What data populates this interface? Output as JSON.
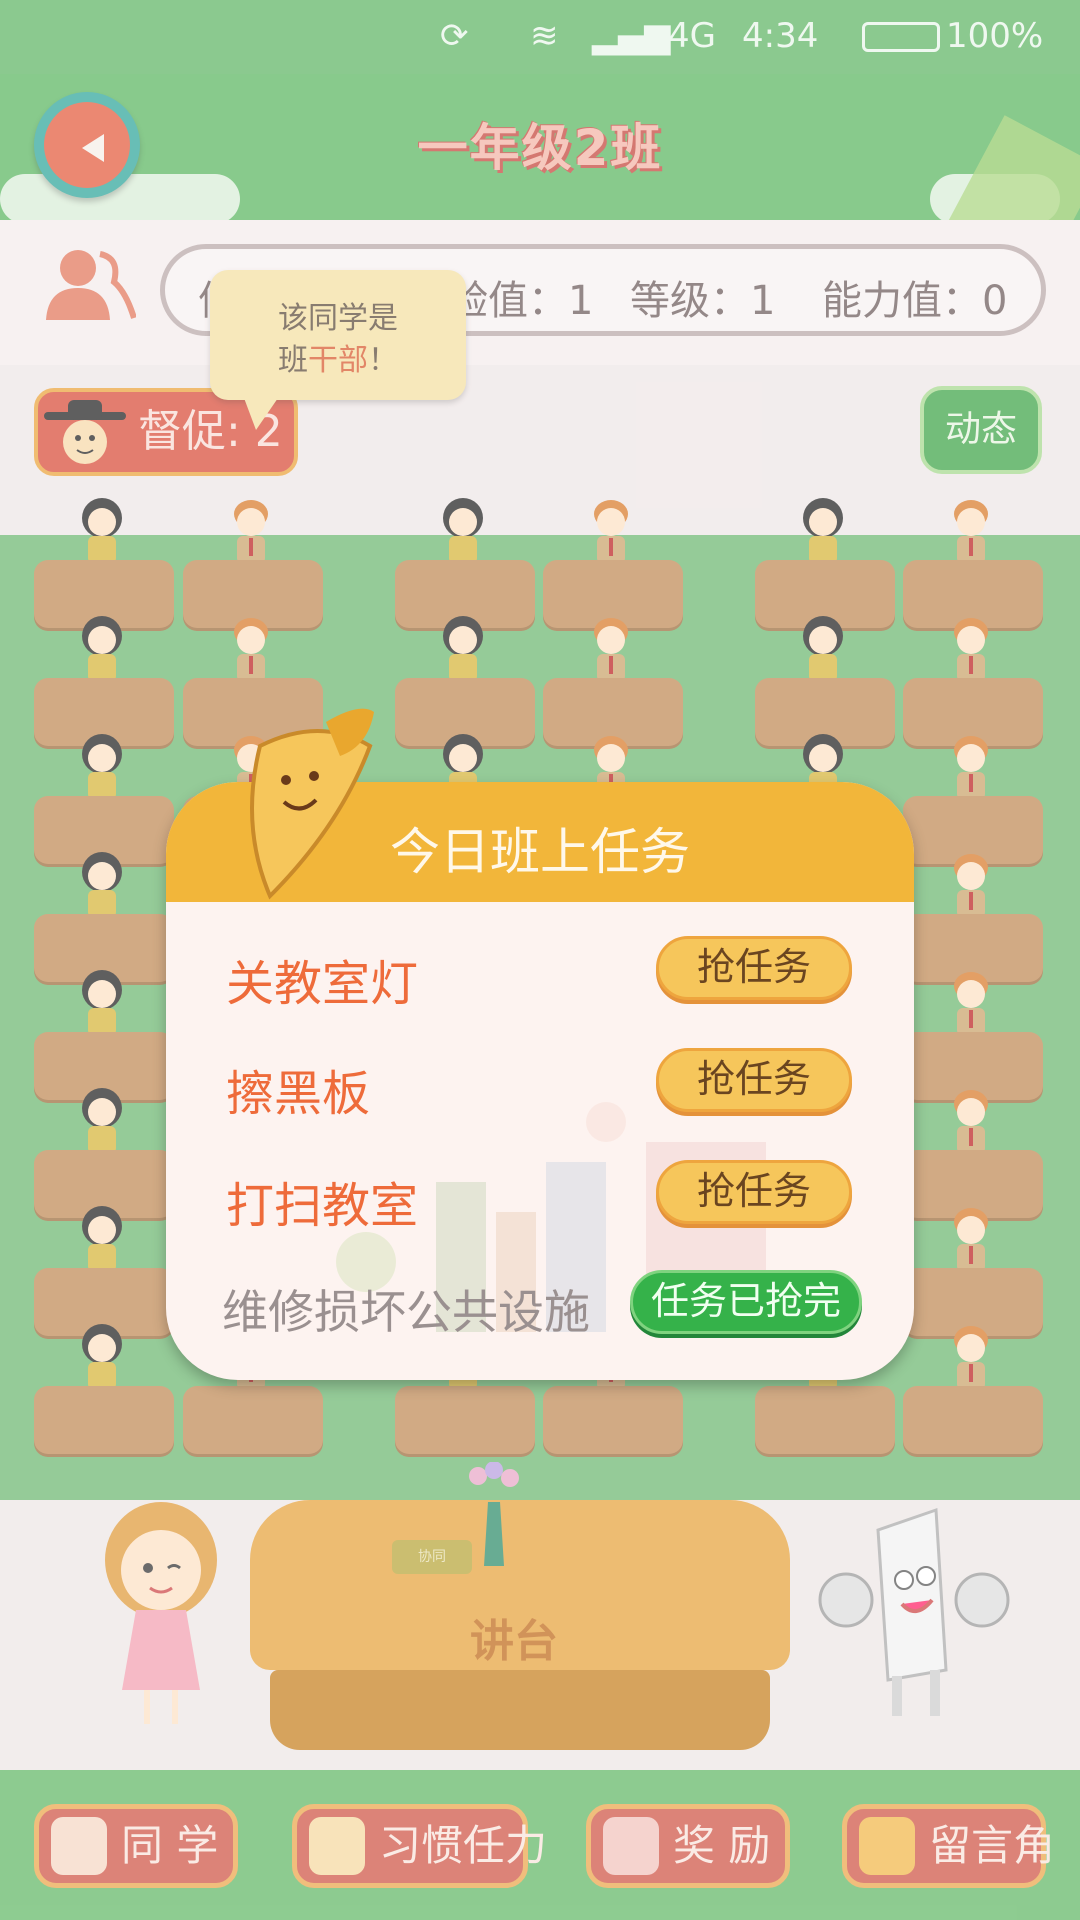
{
  "status_bar": {
    "network": "4G",
    "time": "4:34",
    "battery": "100%"
  },
  "header": {
    "title": "一年级2班"
  },
  "info_bar": {
    "stats": [
      "信",
      "验值：1",
      "等级：1",
      "能力值：0"
    ]
  },
  "tooltip": {
    "line1": "该同学是",
    "line2_prefix": "班",
    "line2_highlight": "干部",
    "line2_suffix": "！"
  },
  "supervise": {
    "label": "督促: 2"
  },
  "dynamic_button": "动态",
  "podium": {
    "label": "讲台",
    "plaque": "协同"
  },
  "modal": {
    "title": "今日班上任务",
    "tasks": [
      {
        "name": "关教室灯",
        "action": "抢任务"
      },
      {
        "name": "擦黑板",
        "action": "抢任务"
      },
      {
        "name": "打扫教室",
        "action": "抢任务"
      },
      {
        "name": "维修损坏公共设施",
        "action": "任务已抢完"
      }
    ]
  },
  "bottom_nav": [
    {
      "label": "同 学",
      "icon": "classmate-icon"
    },
    {
      "label": "习惯任力",
      "icon": "footprint-icon"
    },
    {
      "label": "奖 励",
      "icon": "heart-icon"
    },
    {
      "label": "留言角",
      "icon": "book-icon"
    }
  ],
  "colors": {
    "accent": "#f2b63a",
    "primary_green": "#5ab660",
    "task_text": "#ee6b3a",
    "done_green": "#35b24a"
  }
}
